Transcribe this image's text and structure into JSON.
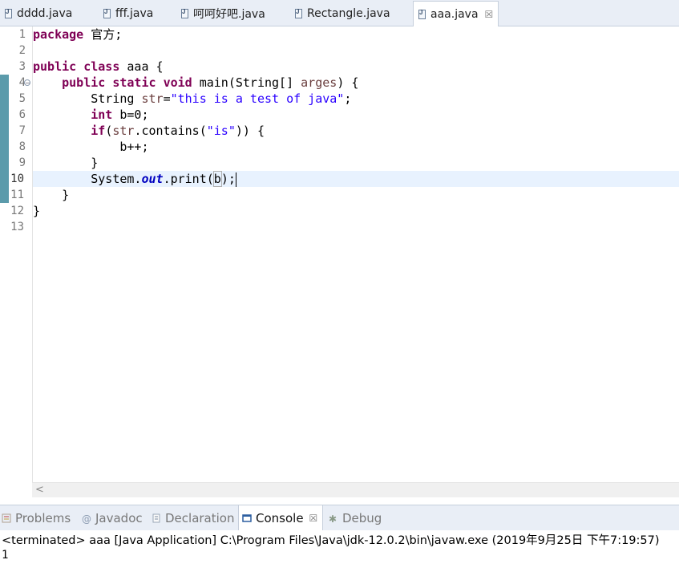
{
  "editor_tabs": [
    {
      "label": "dddd.java",
      "active": false
    },
    {
      "label": "fff.java",
      "active": false
    },
    {
      "label": "呵呵好吧.java",
      "active": false
    },
    {
      "label": "Rectangle.java",
      "active": false
    },
    {
      "label": "aaa.java",
      "active": true
    }
  ],
  "close_glyph": "☒",
  "editor": {
    "line_numbers": [
      "1",
      "2",
      "3",
      "4",
      "5",
      "6",
      "7",
      "8",
      "9",
      "10",
      "11",
      "12",
      "13"
    ],
    "current_line": "10",
    "code": {
      "l1_kw": "package",
      "l1_rest": " 官方;",
      "l3_kw1": "public",
      "l3_kw2": "class",
      "l3_rest": " aaa {",
      "l4_kw1": "public",
      "l4_kw2": "static",
      "l4_kw3": "void",
      "l4_a": " main(String[] ",
      "l4_param": "arges",
      "l4_b": ") {",
      "l5_a": "String ",
      "l5_var": "str",
      "l5_b": "=",
      "l5_str": "\"this is a test of java\"",
      "l5_c": ";",
      "l6_kw": "int",
      "l6_rest": " b=0;",
      "l7_kw": "if",
      "l7_a": "(",
      "l7_var": "str",
      "l7_b": ".contains(",
      "l7_str": "\"is\"",
      "l7_c": ")) {",
      "l8": "b++;",
      "l9": "}",
      "l10_a": "System.",
      "l10_static": "out",
      "l10_b": ".print(",
      "l10_bracket": "b",
      "l10_c": ");",
      "l11": "}",
      "l12": "}"
    }
  },
  "view_tabs": [
    {
      "label": "Problems",
      "icon": "problems-icon",
      "active": false
    },
    {
      "label": "Javadoc",
      "icon": "at-icon",
      "active": false
    },
    {
      "label": "Declaration",
      "icon": "declaration-icon",
      "active": false
    },
    {
      "label": "Console",
      "icon": "console-icon",
      "active": true
    },
    {
      "label": "Debug",
      "icon": "bug-icon",
      "active": false
    }
  ],
  "icon_glyphs": {
    "at": "@",
    "bug": "✱",
    "fold": "−",
    "scroll_left": "<"
  },
  "console": {
    "description": "<terminated> aaa [Java Application] C:\\Program Files\\Java\\jdk-12.0.2\\bin\\javaw.exe (2019年9月25日 下午7:19:57)",
    "output": "1"
  },
  "colors": {
    "keyword": "#7f0055",
    "string": "#2a00ff",
    "static_field": "#0000c0",
    "local_var": "#6a3e3e",
    "current_line_bg": "#e8f2fe",
    "change_bar": "#5b9bab"
  }
}
